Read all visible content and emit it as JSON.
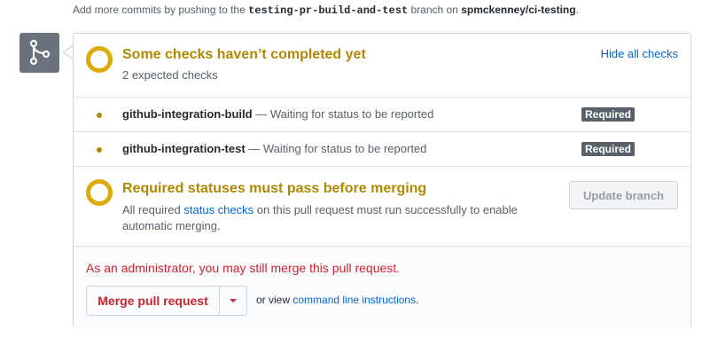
{
  "hint": {
    "prefix": "Add more commits by pushing to the",
    "branch": "testing-pr-build-and-test",
    "middle": "branch on",
    "repo": "spmckenney/ci-testing",
    "suffix": "."
  },
  "checks": {
    "title": "Some checks haven’t completed yet",
    "subtitle": "2 expected checks",
    "toggle_link": "Hide all checks",
    "items": [
      {
        "context": "github-integration-build",
        "description": "— Waiting for status to be reported",
        "badge": "Required"
      },
      {
        "context": "github-integration-test",
        "description": "— Waiting for status to be reported",
        "badge": "Required"
      }
    ]
  },
  "required_status": {
    "title": "Required statuses must pass before merging",
    "desc_before": "All required",
    "desc_link": "status checks",
    "desc_after": "on this pull request must run successfully to enable automatic merging.",
    "update_button": "Update branch"
  },
  "merge": {
    "admin_note": "As an administrator, you may still merge this pull request.",
    "button": "Merge pull request",
    "or_view": "or view",
    "cli_link": "command line instructions",
    "period": "."
  },
  "colors": {
    "pending": "#dbab09",
    "pending_text": "#b08800",
    "danger": "#cb2431",
    "link": "#0366d6",
    "icon_bg": "#6a737d"
  },
  "icons": {
    "merge_status": "git-merge-icon",
    "pending": "pending-ring-icon",
    "dropdown": "caret-down-icon"
  }
}
